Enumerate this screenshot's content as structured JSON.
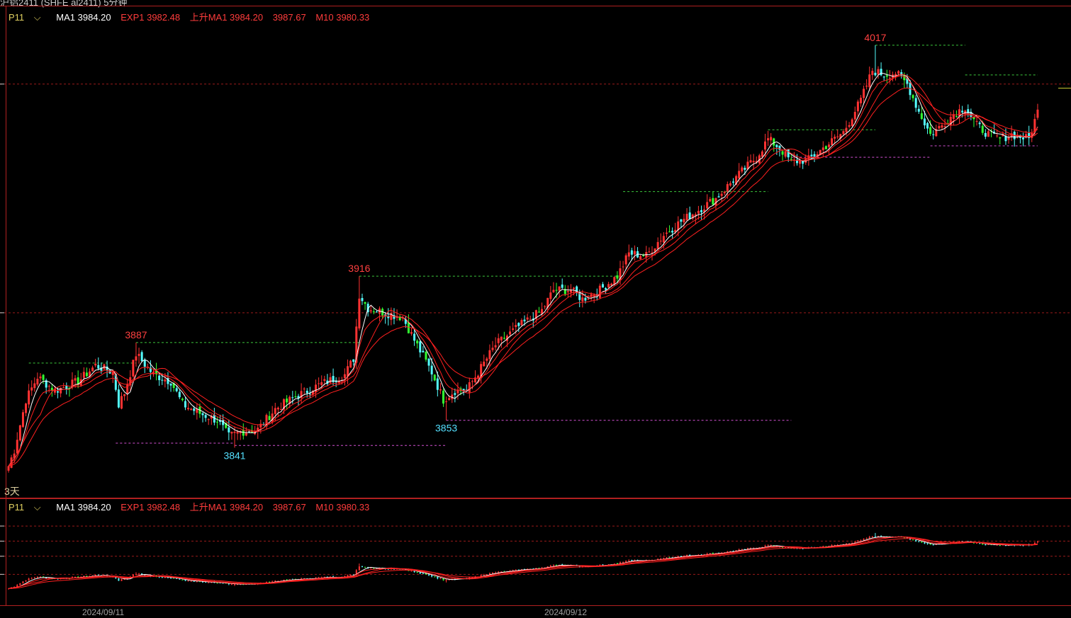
{
  "window": {
    "title": "沪铝2411 (SHFE al2411) 5分钟"
  },
  "legend": {
    "period": "P11",
    "ma1": "MA1 3984.20",
    "exp1": "EXP1 3982.48",
    "up_ma1": "上升MA1 3984.20",
    "v4": "3987.67",
    "m10": "M10 3980.33"
  },
  "period_label": "3天",
  "dates": [
    "2024/09/11",
    "2024/09/12"
  ],
  "colors": {
    "up": "#ff3232",
    "down_cyan": "#54ffff",
    "down_green": "#32ff32",
    "ma1": "#ffffff",
    "ma_red": "#ff2020",
    "grid": "#9a1a1a",
    "frame": "#b02020",
    "resistance": "#3cc83c",
    "support": "#d250d2"
  },
  "chart_data": [
    {
      "type": "candlestick",
      "panel": "main",
      "ylim": [
        3830,
        4025
      ],
      "swing_labels": [
        {
          "text": "3887",
          "kind": "high",
          "value": 3887,
          "bar": 44
        },
        {
          "text": "3841",
          "kind": "low",
          "value": 3841,
          "bar": 78
        },
        {
          "text": "3916",
          "kind": "high",
          "value": 3916,
          "bar": 121
        },
        {
          "text": "3853",
          "kind": "low",
          "value": 3853,
          "bar": 151
        },
        {
          "text": "4017",
          "kind": "high",
          "value": 4017,
          "bar": 299
        }
      ],
      "levels": [
        {
          "kind": "resistance",
          "value": 3878,
          "from_bar": 7,
          "to_bar": 44
        },
        {
          "kind": "resistance",
          "value": 3887,
          "from_bar": 44,
          "to_bar": 121
        },
        {
          "kind": "resistance",
          "value": 3916,
          "from_bar": 121,
          "to_bar": 212
        },
        {
          "kind": "resistance",
          "value": 3953,
          "from_bar": 212,
          "to_bar": 262
        },
        {
          "kind": "resistance",
          "value": 3980,
          "from_bar": 262,
          "to_bar": 299
        },
        {
          "kind": "resistance",
          "value": 4017,
          "from_bar": 299,
          "to_bar": 330
        },
        {
          "kind": "resistance",
          "value": 4004,
          "from_bar": 330,
          "to_bar": 355
        },
        {
          "kind": "support",
          "value": 3843,
          "from_bar": 37,
          "to_bar": 78
        },
        {
          "kind": "support",
          "value": 3842,
          "from_bar": 78,
          "to_bar": 151
        },
        {
          "kind": "support",
          "value": 3853,
          "from_bar": 151,
          "to_bar": 270
        },
        {
          "kind": "support",
          "value": 3968,
          "from_bar": 270,
          "to_bar": 318
        },
        {
          "kind": "support",
          "value": 3973,
          "from_bar": 318,
          "to_bar": 355
        }
      ],
      "anchors": [
        [
          0,
          3833
        ],
        [
          2,
          3840
        ],
        [
          6,
          3862
        ],
        [
          10,
          3872
        ],
        [
          16,
          3866
        ],
        [
          24,
          3870
        ],
        [
          30,
          3877
        ],
        [
          36,
          3874
        ],
        [
          38,
          3860
        ],
        [
          40,
          3865
        ],
        [
          44,
          3882
        ],
        [
          50,
          3873
        ],
        [
          56,
          3870
        ],
        [
          60,
          3860
        ],
        [
          66,
          3856
        ],
        [
          72,
          3853
        ],
        [
          76,
          3846
        ],
        [
          80,
          3848
        ],
        [
          86,
          3849
        ],
        [
          92,
          3858
        ],
        [
          100,
          3864
        ],
        [
          108,
          3869
        ],
        [
          116,
          3873
        ],
        [
          119,
          3880
        ],
        [
          121,
          3908
        ],
        [
          124,
          3902
        ],
        [
          130,
          3900
        ],
        [
          136,
          3898
        ],
        [
          140,
          3888
        ],
        [
          146,
          3874
        ],
        [
          150,
          3862
        ],
        [
          154,
          3866
        ],
        [
          158,
          3866
        ],
        [
          162,
          3874
        ],
        [
          168,
          3886
        ],
        [
          176,
          3894
        ],
        [
          184,
          3901
        ],
        [
          188,
          3910
        ],
        [
          194,
          3910
        ],
        [
          198,
          3906
        ],
        [
          204,
          3910
        ],
        [
          210,
          3916
        ],
        [
          214,
          3926
        ],
        [
          220,
          3925
        ],
        [
          226,
          3934
        ],
        [
          232,
          3940
        ],
        [
          238,
          3945
        ],
        [
          244,
          3950
        ],
        [
          250,
          3958
        ],
        [
          258,
          3968
        ],
        [
          262,
          3976
        ],
        [
          266,
          3972
        ],
        [
          270,
          3966
        ],
        [
          276,
          3967
        ],
        [
          282,
          3973
        ],
        [
          288,
          3979
        ],
        [
          294,
          3993
        ],
        [
          298,
          4006
        ],
        [
          302,
          4004
        ],
        [
          306,
          4005
        ],
        [
          310,
          4000
        ],
        [
          314,
          3988
        ],
        [
          318,
          3978
        ],
        [
          322,
          3982
        ],
        [
          326,
          3987
        ],
        [
          330,
          3990
        ],
        [
          334,
          3982
        ],
        [
          338,
          3978
        ],
        [
          342,
          3976
        ],
        [
          346,
          3978
        ],
        [
          352,
          3976
        ],
        [
          355,
          3988
        ]
      ]
    },
    {
      "type": "candlestick",
      "panel": "sub",
      "note": "compressed overview of the same series",
      "ylim": [
        3780,
        4080
      ]
    }
  ]
}
